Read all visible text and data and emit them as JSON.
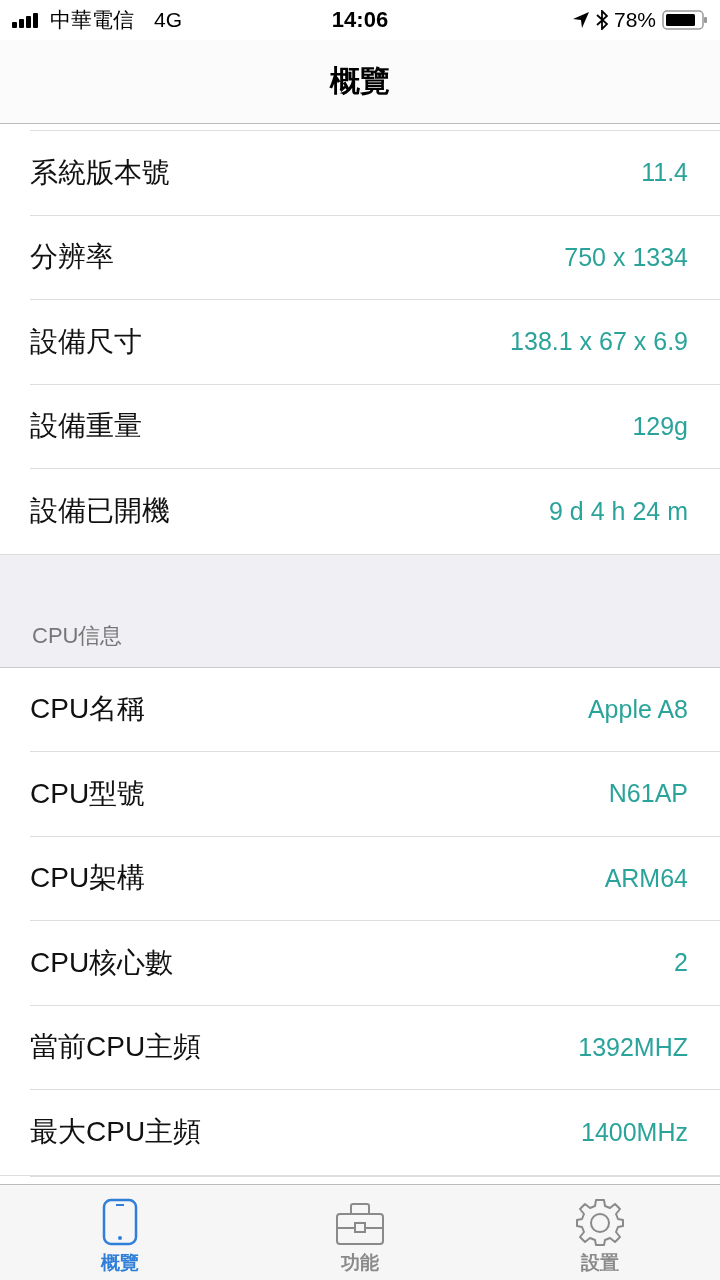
{
  "status_bar": {
    "carrier": "中華電信",
    "network": "4G",
    "time": "14:06",
    "battery": "78%"
  },
  "nav_bar": {
    "title": "概覽"
  },
  "sections": [
    {
      "rows": [
        {
          "label": "系統版本號",
          "value": "11.4"
        },
        {
          "label": "分辨率",
          "value": "750 x 1334"
        },
        {
          "label": "設備尺寸",
          "value": "138.1 x 67 x 6.9"
        },
        {
          "label": "設備重量",
          "value": "129g"
        },
        {
          "label": "設備已開機",
          "value": "9 d 4 h 24 m"
        }
      ]
    },
    {
      "header": "CPU信息",
      "rows": [
        {
          "label": "CPU名稱",
          "value": "Apple A8"
        },
        {
          "label": "CPU型號",
          "value": "N61AP"
        },
        {
          "label": "CPU架構",
          "value": "ARM64"
        },
        {
          "label": "CPU核心數",
          "value": "2"
        },
        {
          "label": "當前CPU主頻",
          "value": "1392MHZ"
        },
        {
          "label": "最大CPU主頻",
          "value": "1400MHz"
        }
      ]
    }
  ],
  "tab_bar": [
    {
      "kind": "phone",
      "label": "概覽",
      "selected": true
    },
    {
      "kind": "briefcase",
      "label": "功能",
      "selected": false
    },
    {
      "kind": "gear",
      "label": "設置",
      "selected": false
    }
  ]
}
